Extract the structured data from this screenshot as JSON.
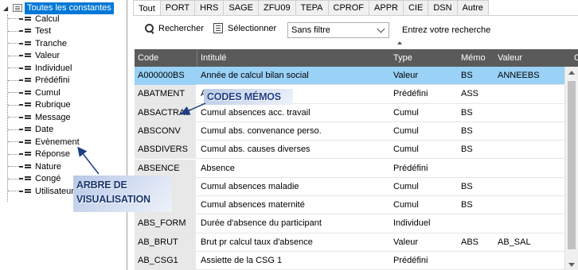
{
  "tree": {
    "root_label": "Toutes les constantes",
    "items": [
      "Calcul",
      "Test",
      "Tranche",
      "Valeur",
      "Individuel",
      "Prédéfini",
      "Cumul",
      "Rubrique",
      "Message",
      "Date",
      "Evènement",
      "Réponse",
      "Nature",
      "Congé",
      "Utilisateur"
    ]
  },
  "tabs": [
    "Tout",
    "PORT",
    "HRS",
    "SAGE",
    "ZFU09",
    "TEPA",
    "CPROF",
    "APPR",
    "CIE",
    "DSN",
    "Autre"
  ],
  "active_tab": "Tout",
  "toolbar": {
    "search_label": "Rechercher",
    "select_label": "Sélectionner",
    "filter_value": "Sans filtre",
    "search_prompt": "Entrez votre recherche"
  },
  "grid": {
    "columns": [
      "Code",
      "Intitulé",
      "Type",
      "Mémo",
      "Valeur",
      "C"
    ],
    "rows": [
      {
        "code": "A000000BS",
        "intitule": "Année de calcul bilan social",
        "type": "Valeur",
        "memo": "BS",
        "valeur": "ANNEEBS",
        "selected": true
      },
      {
        "code": "ABATMENT",
        "intitule": "A",
        "type": "Prédéfini",
        "memo": "ASS",
        "valeur": ""
      },
      {
        "code": "ABSACTRAV",
        "intitule": "Cumul absences acc. travail",
        "type": "Cumul",
        "memo": "BS",
        "valeur": ""
      },
      {
        "code": "ABSCONV",
        "intitule": "Cumul abs. convenance perso.",
        "type": "Cumul",
        "memo": "BS",
        "valeur": ""
      },
      {
        "code": "ABSDIVERS",
        "intitule": "Cumul abs. causes diverses",
        "type": "Cumul",
        "memo": "BS",
        "valeur": ""
      },
      {
        "code": "ABSENCE",
        "intitule": "Absence",
        "type": "Prédéfini",
        "memo": "",
        "valeur": ""
      },
      {
        "code": "",
        "intitule": "Cumul absences maladie",
        "type": "Cumul",
        "memo": "BS",
        "valeur": ""
      },
      {
        "code": "ER",
        "intitule": "Cumul absences maternité",
        "type": "Cumul",
        "memo": "BS",
        "valeur": ""
      },
      {
        "code": "ABS_FORM",
        "intitule": "Durée d'absence du participant",
        "type": "Individuel",
        "memo": "",
        "valeur": ""
      },
      {
        "code": "AB_BRUT",
        "intitule": "Brut pr calcul taux d'absence",
        "type": "Valeur",
        "memo": "ABS",
        "valeur": "AB_SAL"
      },
      {
        "code": "AB_CSG1",
        "intitule": "Assiette de la CSG 1",
        "type": "Prédéfini",
        "memo": "",
        "valeur": ""
      }
    ]
  },
  "annotations": {
    "arbre_line1": "ARBRE DE",
    "arbre_line2": "VISUALISATION",
    "codes_memos": "CODES MÉMOS"
  },
  "colors": {
    "selection": "#0078d7",
    "row_selected": "#99d1f7",
    "header_bg": "#5a5a5a",
    "callout_text": "#1f3f82"
  }
}
